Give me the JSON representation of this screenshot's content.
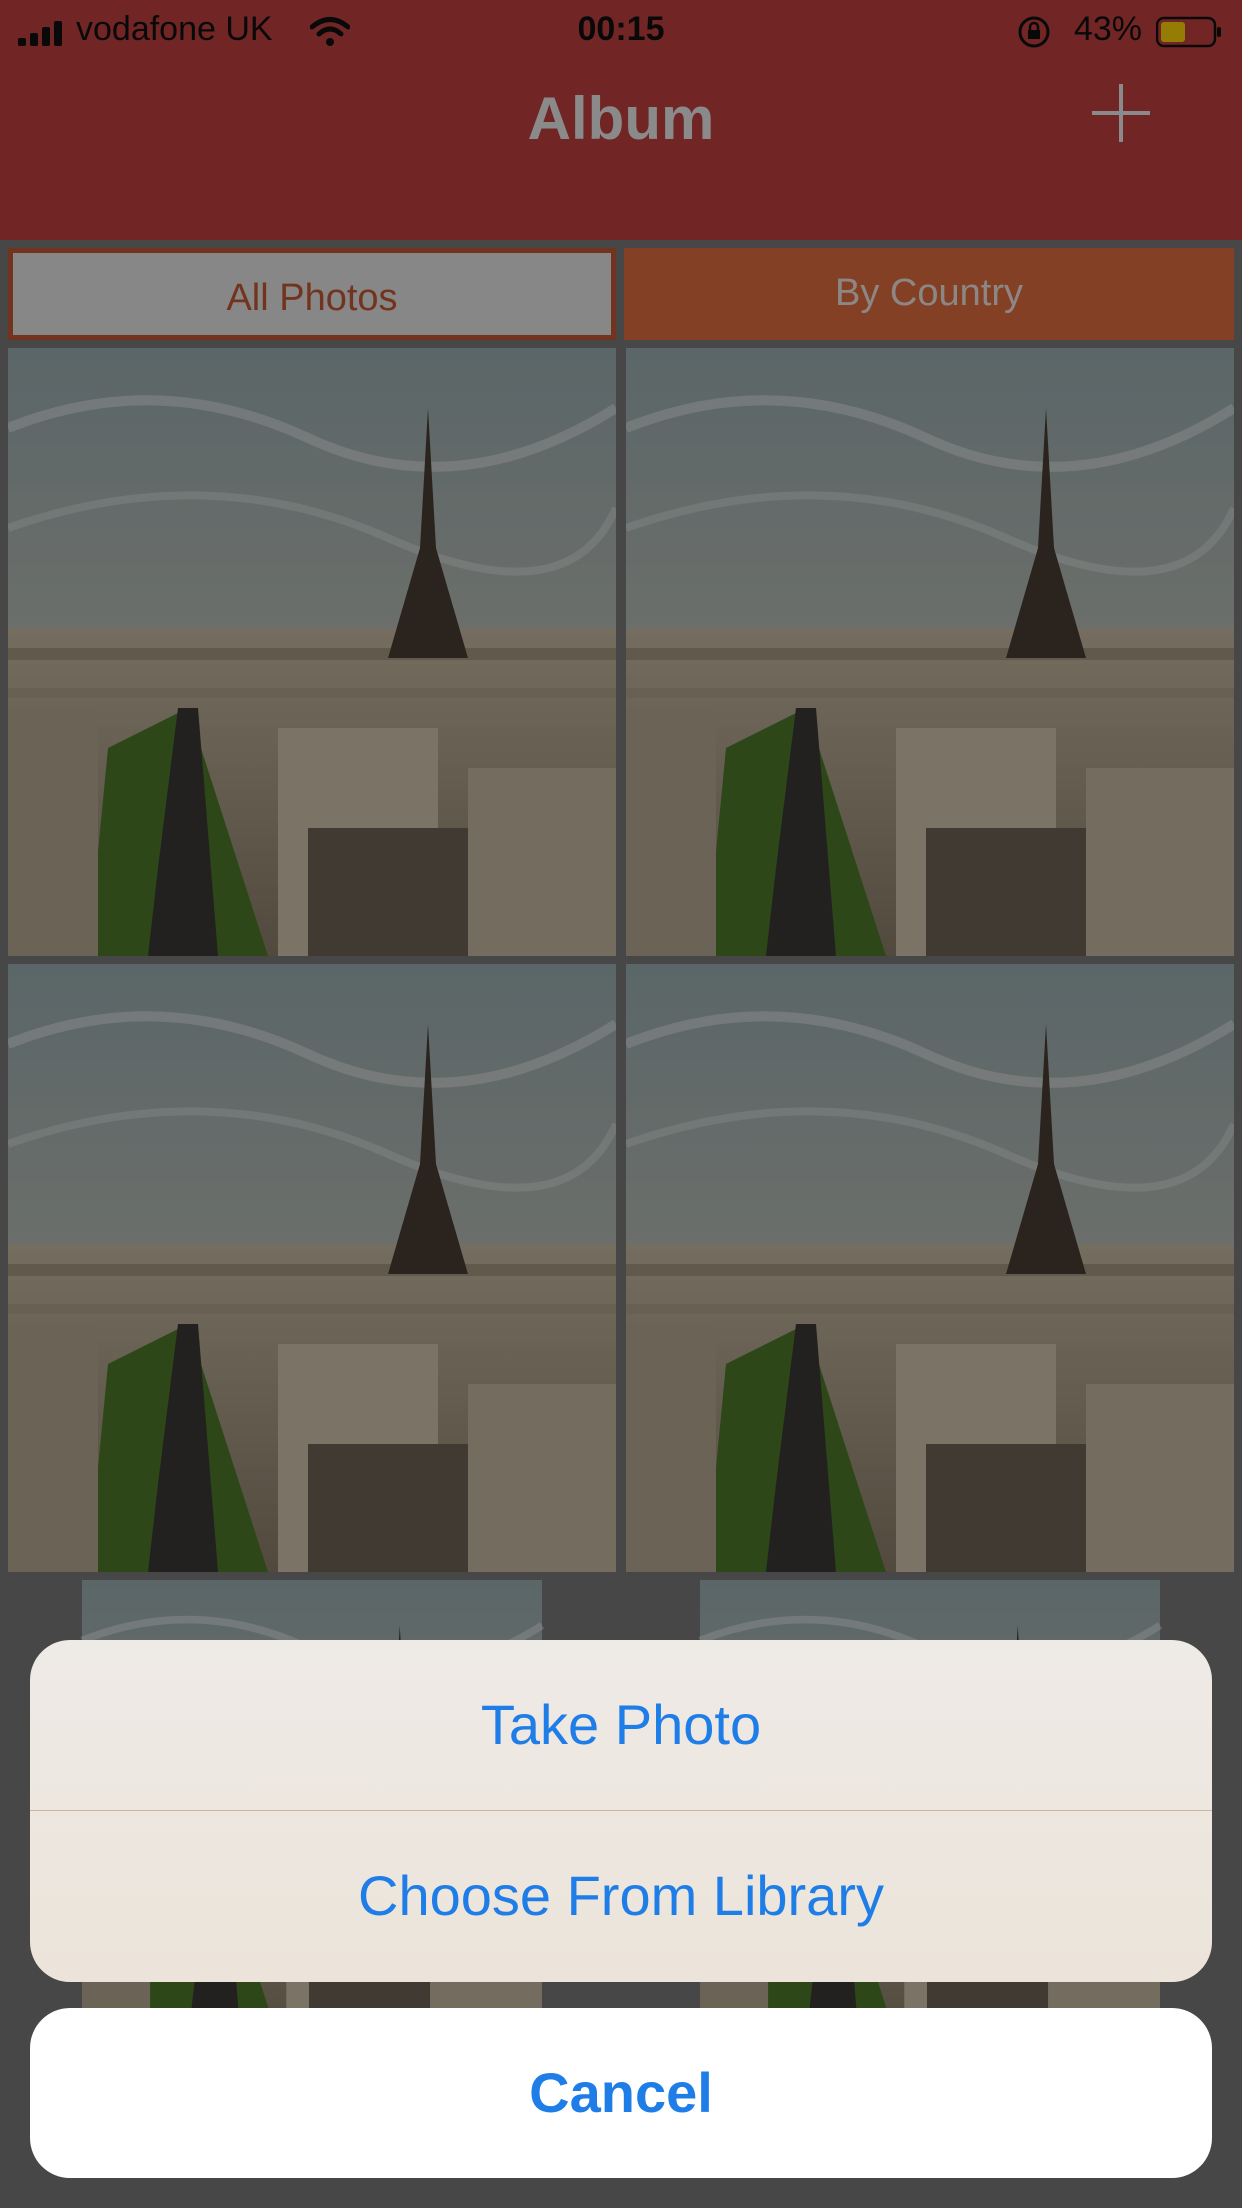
{
  "status_bar": {
    "carrier": "vodafone UK",
    "time": "00:15",
    "battery_percent": "43%",
    "battery_level": 0.43,
    "icons": [
      "signal-icon",
      "wifi-icon",
      "rotation-lock-icon",
      "battery-icon"
    ]
  },
  "nav": {
    "title": "Album",
    "add_icon": "plus-icon"
  },
  "segments": [
    {
      "label": "All Photos",
      "selected": true
    },
    {
      "label": "By Country",
      "selected": false
    }
  ],
  "photos": {
    "count": 6,
    "subject": "eiffel-tower-city-photo"
  },
  "action_sheet": {
    "take_photo": "Take Photo",
    "choose_library": "Choose From Library",
    "cancel": "Cancel"
  },
  "colors": {
    "nav_bar": "#C44040",
    "selected_segment_border": "#C75A36",
    "unselected_segment": "#E46F3E",
    "action_text": "#1f7de8"
  }
}
